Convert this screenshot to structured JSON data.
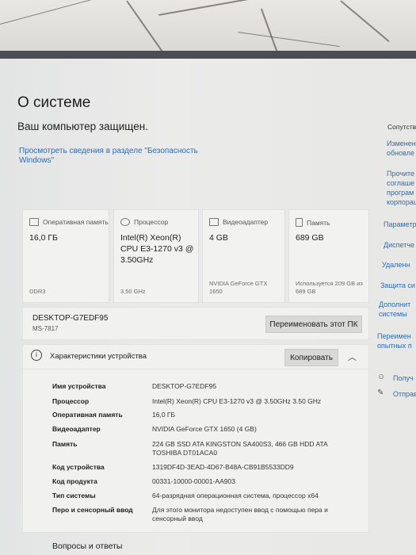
{
  "page": {
    "title": "О системе",
    "protected": "Ваш компьютер защищен.",
    "security_link": "Просмотреть сведения в разделе \"Безопасность Windows\""
  },
  "cards": [
    {
      "icon": "ram-icon",
      "label": "Оперативная память",
      "value": "16,0 ГБ",
      "sub": "DDR3"
    },
    {
      "icon": "cpu-icon",
      "label": "Процессор",
      "value": "Intel(R) Xeon(R) CPU E3-1270 v3 @ 3.50GHz",
      "sub": "3,50 GHz"
    },
    {
      "icon": "gpu-icon",
      "label": "Видеоадаптер",
      "value": "4 GB",
      "sub": "NVIDIA GeForce GTX 1650"
    },
    {
      "icon": "storage-icon",
      "label": "Память",
      "value": "689 GB",
      "sub": "Используется 209 GB из 689 GB"
    }
  ],
  "device": {
    "name": "DESKTOP-G7EDF95",
    "model": "MS-7817",
    "rename_button": "Переименовать этот ПК"
  },
  "specs": {
    "header": "Характеристики устройства",
    "copy_button": "Копировать",
    "rows": [
      {
        "key": "Имя устройства",
        "value": "DESKTOP-G7EDF95"
      },
      {
        "key": "Процессор",
        "value": "Intel(R) Xeon(R) CPU E3-1270 v3 @ 3.50GHz   3.50 GHz"
      },
      {
        "key": "Оперативная память",
        "value": "16,0 ГБ"
      },
      {
        "key": "Видеоадаптер",
        "value": "NVIDIA GeForce GTX 1650 (4 GB)"
      },
      {
        "key": "Память",
        "value": "224 GB SSD ATA KINGSTON SA400S3, 466 GB HDD ATA TOSHIBA DT01ACA0"
      },
      {
        "key": "Код устройства",
        "value": "1319DF4D-3EAD-4D67-B48A-CB91B5533DD9"
      },
      {
        "key": "Код продукта",
        "value": "00331-10000-00001-AA903"
      },
      {
        "key": "Тип системы",
        "value": "64-разрядная операционная система, процессор x64"
      },
      {
        "key": "Перо и сенсорный ввод",
        "value": "Для этого монитора недоступен ввод с помощью пера и сенсорный ввод"
      }
    ]
  },
  "faq": "Вопросы и ответы",
  "sidebar": {
    "heading": "Сопутств",
    "links": [
      "Изменен обновле",
      "Прочите соглаше програм корпорац",
      "Параметр",
      "Диспетче",
      "Удаленн",
      "Защита си",
      "Дополнит системы",
      "Переимен опытных п"
    ],
    "actions": [
      "Получ",
      "Отправ"
    ]
  }
}
